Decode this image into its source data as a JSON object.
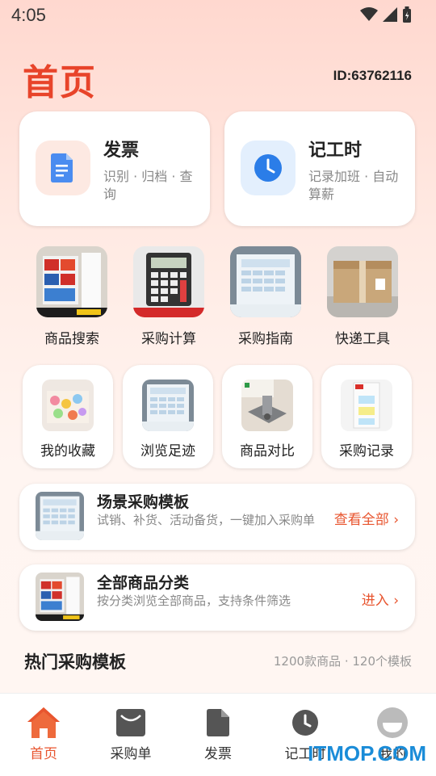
{
  "status": {
    "time": "4:05"
  },
  "header": {
    "title": "首页",
    "user_id": "ID:63762116"
  },
  "cards": [
    {
      "title": "发票",
      "subtitle": "识别 · 归档 · 查询",
      "icon": "document-icon",
      "color": "#4a8cf0",
      "bg": "#fde9e2"
    },
    {
      "title": "记工时",
      "subtitle": "记录加班 · 自动算薪",
      "icon": "clock-icon",
      "color": "#2b7de8",
      "bg": "#e3effd"
    }
  ],
  "tools": [
    {
      "label": "商品搜索",
      "icon": "shelf-product-image"
    },
    {
      "label": "采购计算",
      "icon": "calculator-product-image"
    },
    {
      "label": "采购指南",
      "icon": "sticker-sheet-product-image"
    },
    {
      "label": "快递工具",
      "icon": "shipping-box-product-image"
    }
  ],
  "shortcuts": [
    {
      "label": "我的收藏",
      "icon": "toy-box-product-image"
    },
    {
      "label": "浏览足迹",
      "icon": "sticker-sheet-product-image"
    },
    {
      "label": "商品对比",
      "icon": "metal-bracket-product-image"
    },
    {
      "label": "采购记录",
      "icon": "label-pack-product-image"
    }
  ],
  "banners": [
    {
      "title": "场景采购模板",
      "subtitle": "试销、补货、活动备货，一键加入采购单",
      "action": "查看全部 ›",
      "icon": "sticker-sheet-product-image"
    },
    {
      "title": "全部商品分类",
      "subtitle": "按分类浏览全部商品，支持条件筛选",
      "action": "进入 ›",
      "icon": "shelf-product-image"
    }
  ],
  "hot": {
    "title": "热门采购模板",
    "meta": "1200款商品 · 120个模板"
  },
  "tabs": [
    {
      "label": "首页",
      "icon": "home-icon",
      "active": true
    },
    {
      "label": "采购单",
      "icon": "envelope-icon",
      "active": false
    },
    {
      "label": "发票",
      "icon": "document-icon",
      "active": false
    },
    {
      "label": "记工时",
      "icon": "clock-icon",
      "active": false
    },
    {
      "label": "我的",
      "icon": "profile-icon",
      "active": false
    }
  ],
  "watermark": "ITMOP.COM",
  "colors": {
    "accent": "#e8552f",
    "title": "#e8442a",
    "blue": "#2b7de8"
  }
}
